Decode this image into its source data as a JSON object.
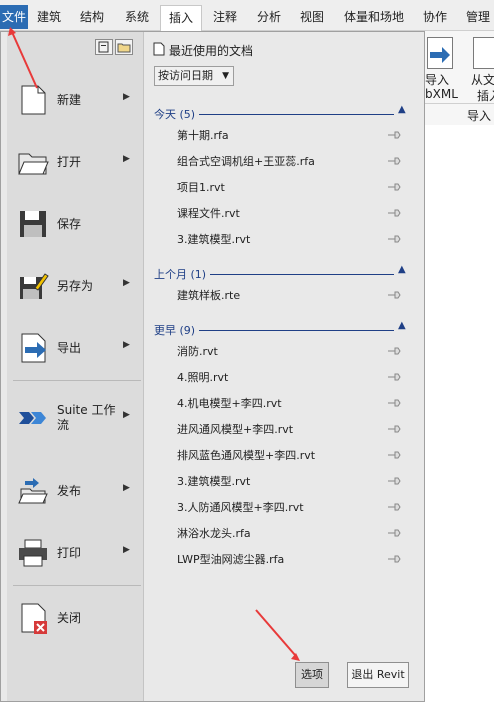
{
  "tabs": {
    "file": "文件",
    "items": [
      "建筑",
      "结构",
      "系统",
      "插入",
      "注释",
      "分析",
      "视图",
      "体量和场地",
      "协作",
      "管理"
    ],
    "active": "插入"
  },
  "ribbon": {
    "import1_line1": "导入",
    "import1_line2": "bXML",
    "import2_line1": "从文",
    "import2_line2": "插入",
    "group_label": "导入"
  },
  "menu": {
    "items": [
      {
        "label": "新建",
        "icon": "new-document-icon",
        "has_submenu": true
      },
      {
        "label": "打开",
        "icon": "open-folder-icon",
        "has_submenu": true
      },
      {
        "label": "保存",
        "icon": "save-disk-icon",
        "has_submenu": false
      },
      {
        "label": "另存为",
        "icon": "save-as-icon",
        "has_submenu": true
      },
      {
        "label": "导出",
        "icon": "export-icon",
        "has_submenu": true
      },
      {
        "label_line1": "Suite 工作",
        "label_line2": "流",
        "icon": "suite-workflow-icon",
        "has_submenu": true
      },
      {
        "label": "发布",
        "icon": "publish-icon",
        "has_submenu": true
      },
      {
        "label": "打印",
        "icon": "printer-icon",
        "has_submenu": true
      },
      {
        "label": "关闭",
        "icon": "close-document-icon",
        "has_submenu": false
      }
    ]
  },
  "recent": {
    "title": "最近使用的文档",
    "sort_value": "按访问日期",
    "groups": [
      {
        "title": "今天 (5)",
        "files": [
          "第十期.rfa",
          "组合式空调机组+王亚蕊.rfa",
          "项目1.rvt",
          "课程文件.rvt",
          "3.建筑模型.rvt"
        ]
      },
      {
        "title": "上个月 (1)",
        "files": [
          "建筑样板.rte"
        ]
      },
      {
        "title": "更早 (9)",
        "files": [
          "消防.rvt",
          "4.照明.rvt",
          "4.机电模型+李四.rvt",
          "进风通风模型+李四.rvt",
          "排风蓝色通风模型+李四.rvt",
          "3.建筑模型.rvt",
          "3.人防通风模型+李四.rvt",
          "淋浴水龙头.rfa",
          "LWP型油网滤尘器.rfa"
        ]
      }
    ]
  },
  "buttons": {
    "options": "选项",
    "exit": "退出 Revit"
  },
  "colors": {
    "file_tab": "#2b6cb3",
    "group_header": "#1f3f86",
    "annotation_arrow": "#e83a3a"
  }
}
